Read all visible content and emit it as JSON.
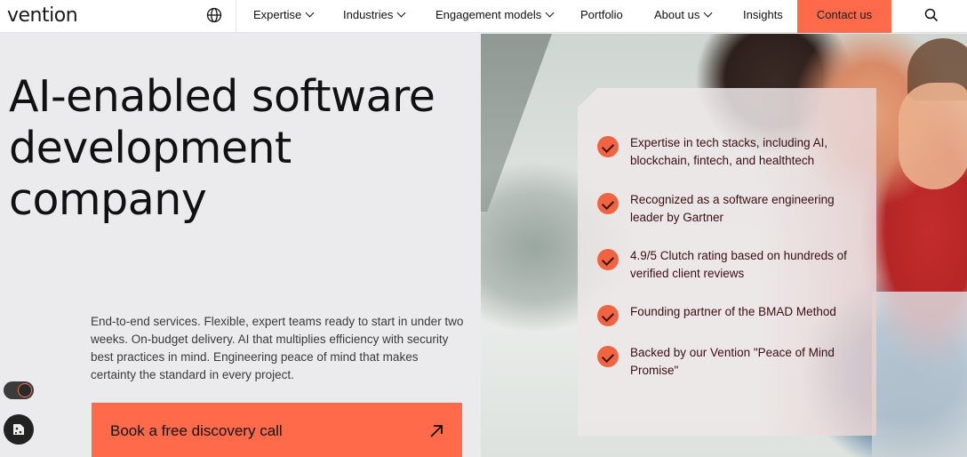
{
  "nav": {
    "logo": "vention",
    "items": [
      {
        "label": "Expertise",
        "dropdown": true
      },
      {
        "label": "Industries",
        "dropdown": true
      },
      {
        "label": "Engagement models",
        "dropdown": true
      },
      {
        "label": "Portfolio",
        "dropdown": false
      },
      {
        "label": "About us",
        "dropdown": true
      },
      {
        "label": "Insights",
        "dropdown": false
      }
    ],
    "contact_label": "Contact us",
    "icons": {
      "language": "globe-icon",
      "search": "search-icon"
    }
  },
  "hero": {
    "title_lines": [
      "AI-enabled software",
      "development",
      "company"
    ],
    "description": "End-to-end services. Flexible, expert teams ready to start in under two weeks. On-budget delivery. AI that multiplies efficiency with security best practices in mind. Engineering peace of mind that makes certainty the standard in every project.",
    "cta_label": "Book a free discovery call",
    "cta_icon": "arrow-up-right-icon"
  },
  "bullets": [
    "Expertise in tech stacks, including AI, blockchain, fintech, and healthtech",
    "Recognized as a software engineering leader by Gartner",
    "4.9/5 Clutch rating based on hundreds of verified client reviews",
    "Founding partner of the BMAD Method",
    "Backed by our Vention \"Peace of Mind Promise\""
  ],
  "colors": {
    "accent": "#ff6b4a",
    "check": "#f06442",
    "bullet_text": "#3a0e14"
  }
}
